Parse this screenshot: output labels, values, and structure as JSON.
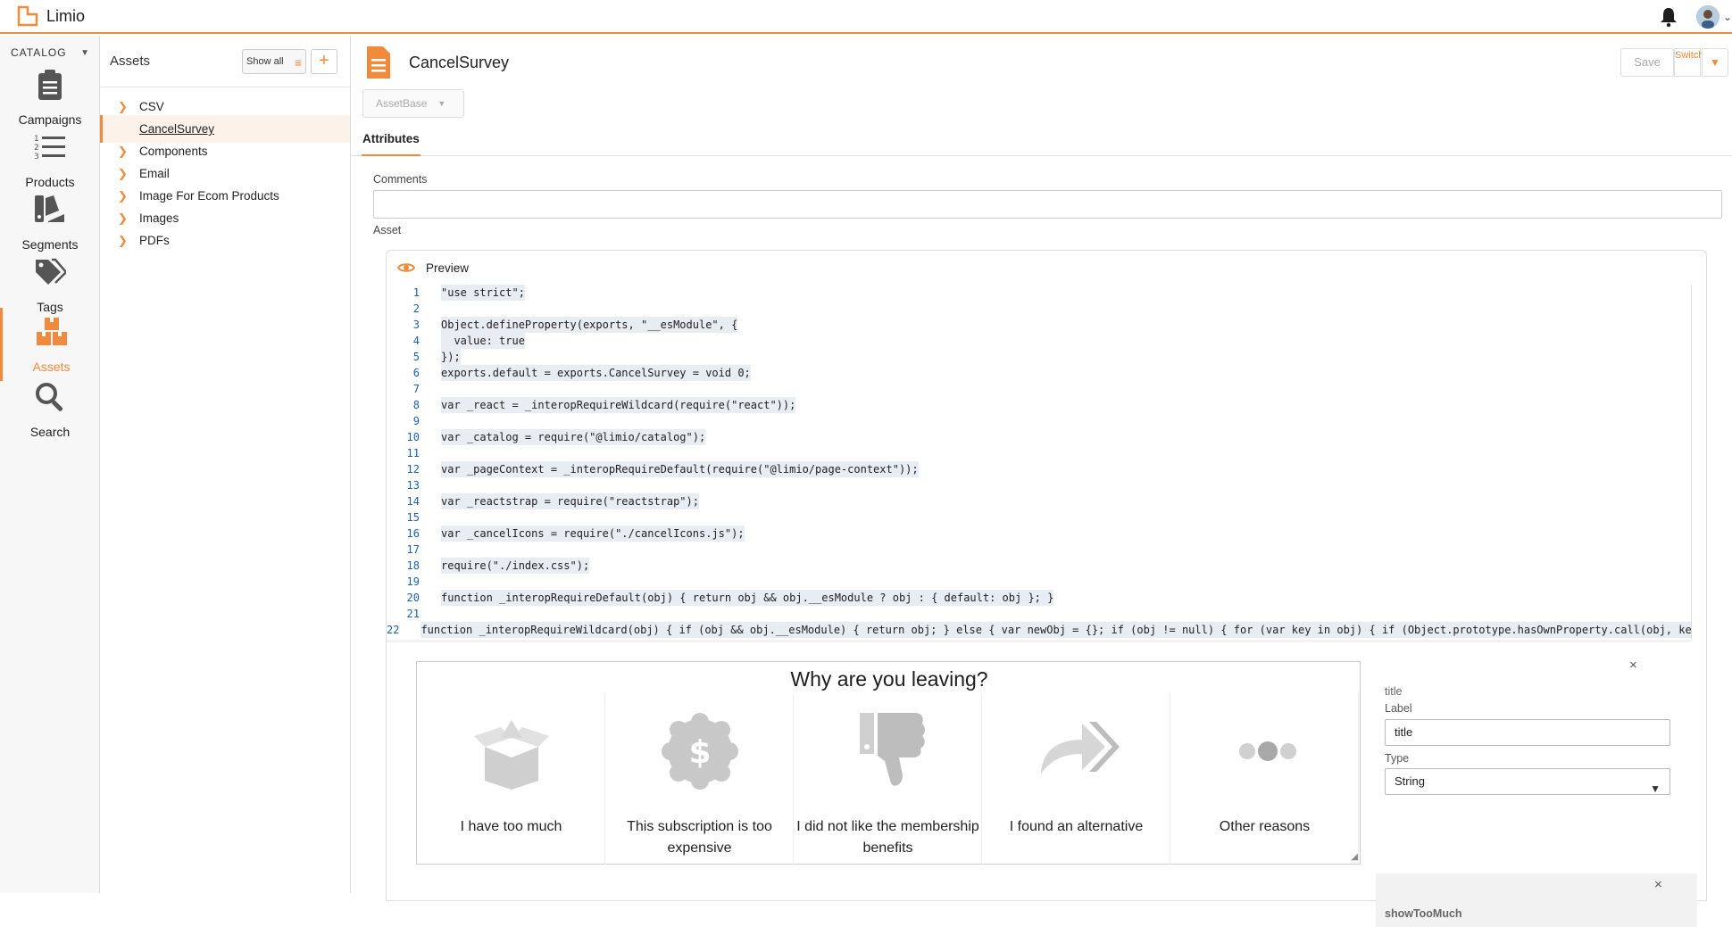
{
  "app": {
    "name": "Limio"
  },
  "rail": {
    "catalog_label": "CATALOG",
    "items": [
      {
        "label": "Campaigns",
        "icon": "clipboard-icon"
      },
      {
        "label": "Products",
        "icon": "numbered-list-icon"
      },
      {
        "label": "Segments",
        "icon": "segments-icon"
      },
      {
        "label": "Tags",
        "icon": "tags-icon"
      },
      {
        "label": "Assets",
        "icon": "assets-boxes-icon"
      },
      {
        "label": "Search",
        "icon": "search-icon"
      }
    ],
    "active": "Assets"
  },
  "tree": {
    "title": "Assets",
    "show_all": "Show all",
    "add": "+",
    "items": [
      {
        "label": "CSV"
      },
      {
        "label": "CancelSurvey"
      },
      {
        "label": "Components"
      },
      {
        "label": "Email"
      },
      {
        "label": "Image For Ecom Products"
      },
      {
        "label": "Images"
      },
      {
        "label": "PDFs"
      }
    ]
  },
  "main": {
    "title": "CancelSurvey",
    "save": "Save",
    "switch_view": "Switch View",
    "asset_base": "AssetBase",
    "tab": "Attributes",
    "comments_label": "Comments",
    "asset_label": "Asset",
    "preview_label": "Preview"
  },
  "code": [
    {
      "n": "1",
      "t": "\"use strict\";"
    },
    {
      "n": "2",
      "t": ""
    },
    {
      "n": "3",
      "t": "Object.defineProperty(exports, \"__esModule\", {"
    },
    {
      "n": "4",
      "t": "  value: true"
    },
    {
      "n": "5",
      "t": "});"
    },
    {
      "n": "6",
      "t": "exports.default = exports.CancelSurvey = void 0;"
    },
    {
      "n": "7",
      "t": ""
    },
    {
      "n": "8",
      "t": "var _react = _interopRequireWildcard(require(\"react\"));"
    },
    {
      "n": "9",
      "t": ""
    },
    {
      "n": "10",
      "t": "var _catalog = require(\"@limio/catalog\");"
    },
    {
      "n": "11",
      "t": ""
    },
    {
      "n": "12",
      "t": "var _pageContext = _interopRequireDefault(require(\"@limio/page-context\"));"
    },
    {
      "n": "13",
      "t": ""
    },
    {
      "n": "14",
      "t": "var _reactstrap = require(\"reactstrap\");"
    },
    {
      "n": "15",
      "t": ""
    },
    {
      "n": "16",
      "t": "var _cancelIcons = require(\"./cancelIcons.js\");"
    },
    {
      "n": "17",
      "t": ""
    },
    {
      "n": "18",
      "t": "require(\"./index.css\");"
    },
    {
      "n": "19",
      "t": ""
    },
    {
      "n": "20",
      "t": "function _interopRequireDefault(obj) { return obj && obj.__esModule ? obj : { default: obj }; }"
    },
    {
      "n": "21",
      "t": ""
    },
    {
      "n": "22",
      "t": "function _interopRequireWildcard(obj) { if (obj && obj.__esModule) { return obj; } else { var newObj = {}; if (obj != null) { for (var key in obj) { if (Object.prototype.hasOwnProperty.call(obj, ke"
    }
  ],
  "survey": {
    "title": "Why are you leaving?",
    "options": [
      {
        "text": "I have too much",
        "icon": "open-box-icon"
      },
      {
        "text": "This subscription is too expensive",
        "icon": "dollar-badge-icon"
      },
      {
        "text": "I did not like the membership benefits",
        "icon": "thumbs-down-icon"
      },
      {
        "text": "I found an alternative",
        "icon": "forward-arrow-icon"
      },
      {
        "text": "Other reasons",
        "icon": "ellipsis-icon"
      }
    ]
  },
  "side": {
    "close": "×",
    "field_name": "title",
    "label_label": "Label",
    "label_value": "title",
    "type_label": "Type",
    "type_value": "String",
    "next_field": "showTooMuch"
  },
  "colors": {
    "accent": "#f08a3c"
  }
}
